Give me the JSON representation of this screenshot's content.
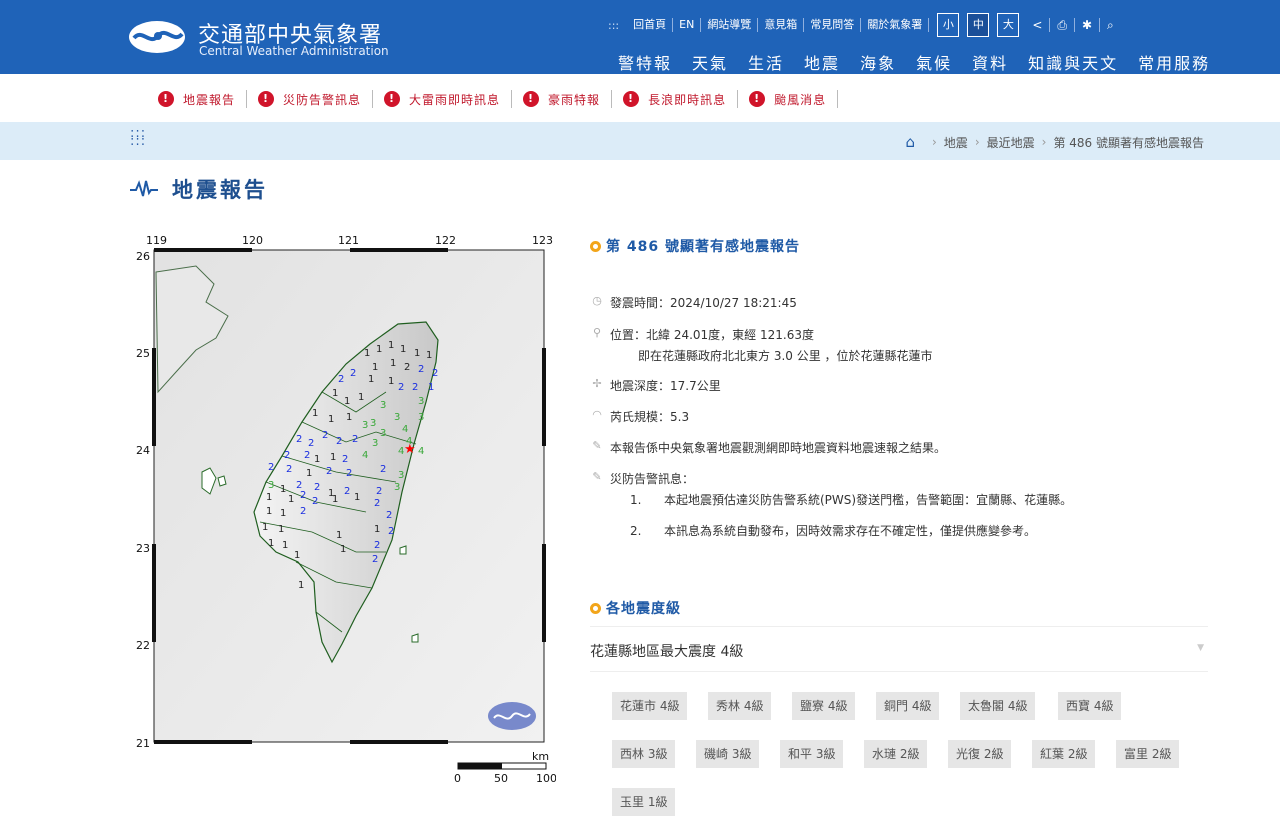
{
  "header": {
    "brand_cn": "交通部中央氣象署",
    "brand_en": "Central Weather Administration",
    "utility_links": [
      "回首頁",
      "EN",
      "網站導覽",
      "意見箱",
      "常見問答",
      "關於氣象署"
    ],
    "font_sizes": [
      "小",
      "中",
      "大"
    ],
    "active_font_size": "中",
    "main_nav": [
      "警特報",
      "天氣",
      "生活",
      "地震",
      "海象",
      "氣候",
      "資料",
      "知識與天文",
      "常用服務"
    ]
  },
  "alerts": [
    "地震報告",
    "災防告警訊息",
    "大雷雨即時訊息",
    "豪雨特報",
    "長浪即時訊息",
    "颱風消息"
  ],
  "breadcrumb": [
    "地震",
    "最近地震",
    "第 486 號顯著有感地震報告"
  ],
  "page_title": "地震報告",
  "map": {
    "x_ticks": [
      "119",
      "120",
      "121",
      "122",
      "123"
    ],
    "y_ticks": [
      "26",
      "25",
      "24",
      "23",
      "22",
      "21"
    ],
    "scale_unit": "km",
    "scale_labels": [
      "0",
      "50",
      "100"
    ],
    "epicenter_color": "#ff0000"
  },
  "report": {
    "title": "第 486 號顯著有感地震報告",
    "time": "發震時間：2024/10/27 18:21:45",
    "location_line1": "位置：北緯 24.01度，東經 121.63度",
    "location_line2": "即在花蓮縣政府北北東方 3.0 公里 ，位於花蓮縣花蓮市",
    "depth": "地震深度：17.7公里",
    "magnitude": "芮氏規模：5.3",
    "note": "本報告係中央氣象署地震觀測網即時地震資料地震速報之結果。",
    "warning_label": "災防告警訊息：",
    "warnings": [
      {
        "num": "1.",
        "text": "本起地震預估達災防告警系統(PWS)發送門檻，告警範圍：宜蘭縣、花蓮縣。"
      },
      {
        "num": "2.",
        "text": "本訊息為系統自動發布，因時效需求存在不確定性，僅提供應變參考。"
      }
    ]
  },
  "intensity": {
    "title": "各地震度級",
    "region": "花蓮縣地區最大震度 4級",
    "stations": [
      "花蓮市 4級",
      "秀林 4級",
      "鹽寮 4級",
      "銅門 4級",
      "太魯閣 4級",
      "西寶 4級",
      "西林 3級",
      "磯崎 3級",
      "和平 3級",
      "水璉 2級",
      "光復 2級",
      "紅葉 2級",
      "富里 2級",
      "玉里 1級"
    ]
  }
}
